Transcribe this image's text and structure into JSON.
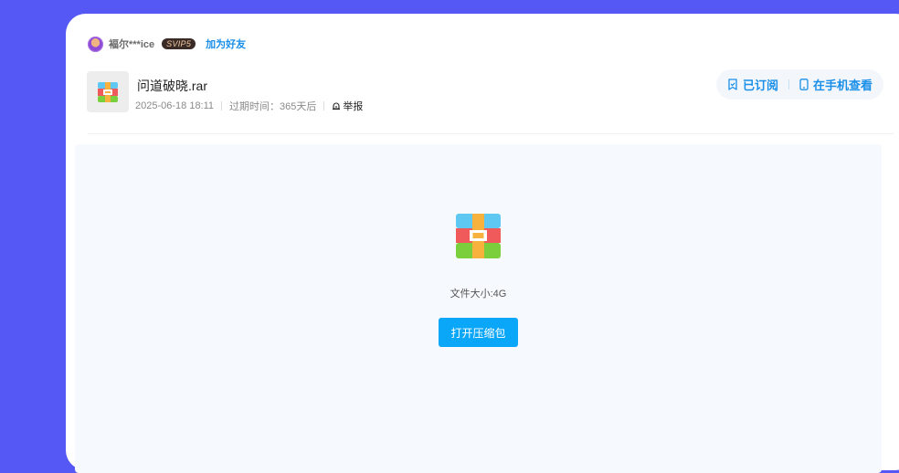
{
  "user": {
    "name": "褔尔***ice",
    "vip_badge": "SVIP5",
    "add_friend_label": "加为好友"
  },
  "file": {
    "name": "问道破晓.rar",
    "date": "2025-06-18 18:11",
    "expire": "过期时间：365天后",
    "report_label": "举报",
    "icon": "archive-icon"
  },
  "actions": {
    "subscribed_label": "已订阅",
    "view_on_phone_label": "在手机查看"
  },
  "preview": {
    "size_text": "文件大小:4G",
    "open_button_label": "打开压缩包"
  },
  "colors": {
    "background": "#5558f5",
    "accent": "#1a8fe8",
    "open_button": "#0aa6f7",
    "preview_bg": "#f6f9fd"
  }
}
